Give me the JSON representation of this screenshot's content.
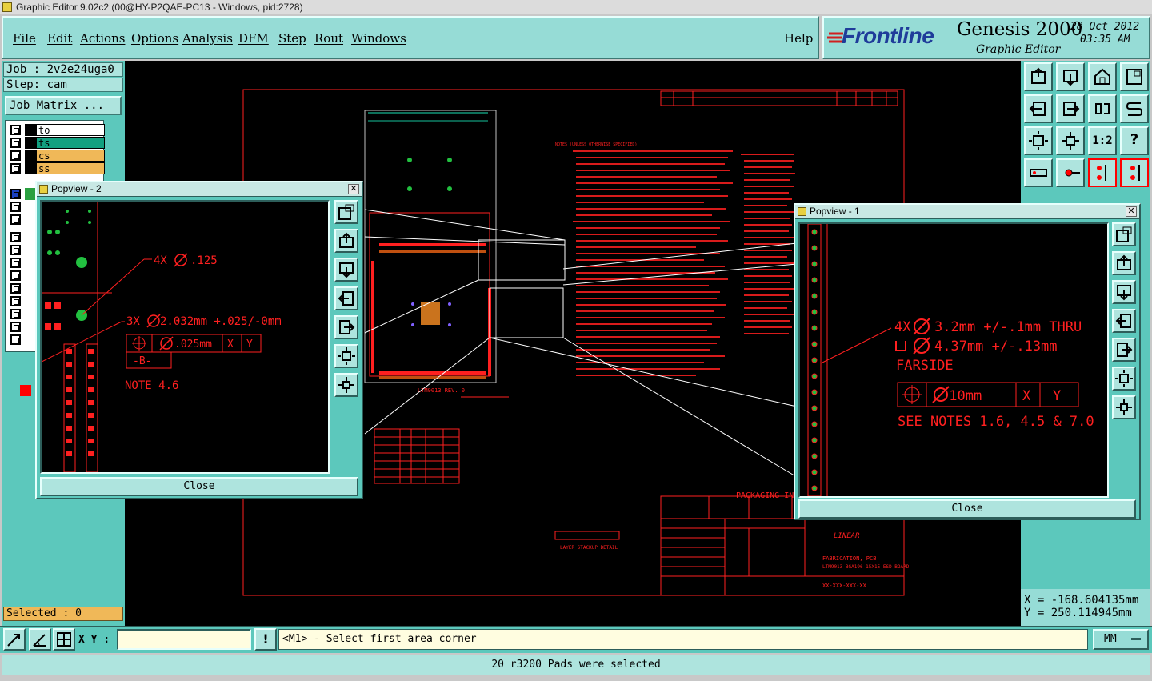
{
  "window": {
    "title": "Graphic Editor 9.02c2 (00@HY-P2QAE-PC13 - Windows, pid:2728)"
  },
  "menu": {
    "items": [
      "File",
      "Edit",
      "Actions",
      "Options",
      "Analysis",
      "DFM",
      "Step",
      "Rout",
      "Windows"
    ],
    "help": "Help"
  },
  "brand": {
    "logo": "Frontline",
    "product": "Genesis 2000",
    "subtitle": "Graphic Editor",
    "date": "28 Oct 2012",
    "time": "03:35 AM"
  },
  "job": {
    "job_label": "Job : 2v2e24uga0",
    "step_label": "Step: cam",
    "matrix_button": "Job Matrix ..."
  },
  "layers": [
    {
      "name": "to",
      "color": "#ffffff"
    },
    {
      "name": "ts",
      "color": "#12a080"
    },
    {
      "name": "cs",
      "color": "#f0b858"
    },
    {
      "name": "ss",
      "color": "#f0b858"
    }
  ],
  "selected_label": "Selected : 0",
  "popup2": {
    "title": "Popview - 2",
    "close_label": "Close",
    "annotations": {
      "a": "4X",
      "a_val": ".125",
      "b": "3X",
      "b_val": "2.032mm +.025/-0mm",
      "fcf_val": ".025mm",
      "fcf_x": "X",
      "fcf_y": "Y",
      "datum": "-B-",
      "note": "NOTE 4.6"
    }
  },
  "popup1": {
    "title": "Popview - 1",
    "close_label": "Close",
    "annotations": {
      "line1_a": "4X",
      "line1_b": "3.2mm +/-.1mm THRU",
      "line2": "4.37mm +/-.13mm",
      "line3": "FARSIDE",
      "fcf_val": ".10mm",
      "fcf_x": "X",
      "fcf_y": "Y",
      "notes": "SEE NOTES 1.6, 4.5 & 7.0"
    }
  },
  "drawing": {
    "notes_title": "NOTES (UNLESS OTHERWISE SPECIFIED)",
    "packaging": "PACKAGING INST",
    "company": "LINEAR",
    "title_line1": "FABRICATION, PCB",
    "title_line2": "LTM9013 BGA196 15X15 ESD BOARD",
    "drawing_no": "XX-XXX-XXX-XX",
    "board_label": "LTM9013 REV. 0",
    "stackup_label": "LAYER STACKUP DETAIL"
  },
  "coords": {
    "x": "X = -168.604135mm",
    "y": "Y = 250.114945mm"
  },
  "bottom": {
    "xy_label": "X Y :",
    "xy_value": "",
    "prompt": "<M1> - Select first area corner",
    "units": "MM"
  },
  "status": "20 r3200 Pads were selected",
  "colors": {
    "panel": "#5cc8bc",
    "panel_light": "#96dcd6",
    "drawing": "#ff2020",
    "canvas": "#000000"
  }
}
